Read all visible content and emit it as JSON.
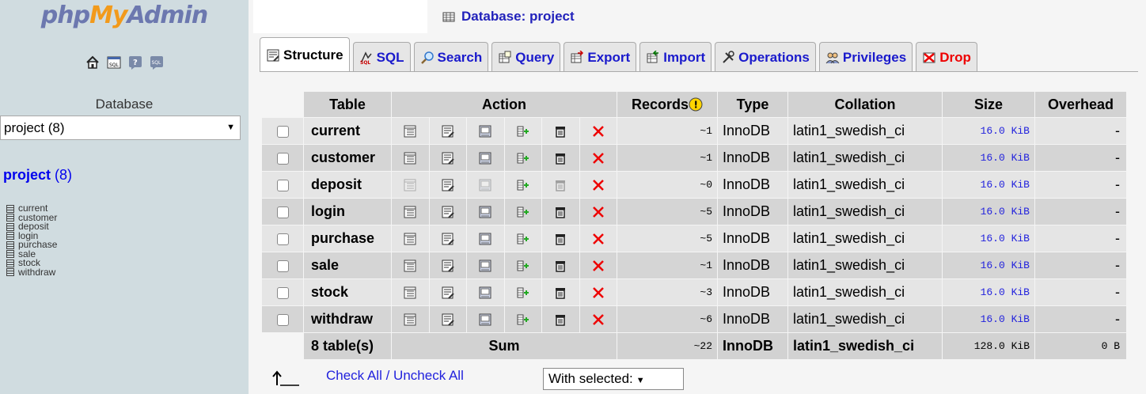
{
  "left": {
    "logo": {
      "php": "php",
      "my": "My",
      "admin": "Admin"
    },
    "icons": [
      "home-icon",
      "sql-query-icon",
      "help-icon",
      "sql-window-icon"
    ],
    "db_label": "Database",
    "db_select": "project (8)",
    "db_link_name": "project",
    "db_link_count": "(8)",
    "tables": [
      "current",
      "customer",
      "deposit",
      "login",
      "purchase",
      "sale",
      "stock",
      "withdraw"
    ]
  },
  "header": {
    "crumb": "Database: project"
  },
  "tabs": [
    {
      "label": "Structure",
      "icon": "structure-icon",
      "active": true
    },
    {
      "label": "SQL",
      "icon": "sql-icon"
    },
    {
      "label": "Search",
      "icon": "search-icon"
    },
    {
      "label": "Query",
      "icon": "query-icon"
    },
    {
      "label": "Export",
      "icon": "export-icon"
    },
    {
      "label": "Import",
      "icon": "import-icon"
    },
    {
      "label": "Operations",
      "icon": "operations-icon"
    },
    {
      "label": "Privileges",
      "icon": "privileges-icon"
    },
    {
      "label": "Drop",
      "icon": "drop-icon"
    }
  ],
  "table": {
    "headers": {
      "table": "Table",
      "action": "Action",
      "records": "Records",
      "type": "Type",
      "collation": "Collation",
      "size": "Size",
      "overhead": "Overhead"
    },
    "rows": [
      {
        "name": "current",
        "records": "~1",
        "type": "InnoDB",
        "collation": "latin1_swedish_ci",
        "size": "16.0 KiB",
        "overhead": "-",
        "empty": false
      },
      {
        "name": "customer",
        "records": "~1",
        "type": "InnoDB",
        "collation": "latin1_swedish_ci",
        "size": "16.0 KiB",
        "overhead": "-",
        "empty": false
      },
      {
        "name": "deposit",
        "records": "~0",
        "type": "InnoDB",
        "collation": "latin1_swedish_ci",
        "size": "16.0 KiB",
        "overhead": "-",
        "empty": true
      },
      {
        "name": "login",
        "records": "~5",
        "type": "InnoDB",
        "collation": "latin1_swedish_ci",
        "size": "16.0 KiB",
        "overhead": "-",
        "empty": false
      },
      {
        "name": "purchase",
        "records": "~5",
        "type": "InnoDB",
        "collation": "latin1_swedish_ci",
        "size": "16.0 KiB",
        "overhead": "-",
        "empty": false
      },
      {
        "name": "sale",
        "records": "~1",
        "type": "InnoDB",
        "collation": "latin1_swedish_ci",
        "size": "16.0 KiB",
        "overhead": "-",
        "empty": false
      },
      {
        "name": "stock",
        "records": "~3",
        "type": "InnoDB",
        "collation": "latin1_swedish_ci",
        "size": "16.0 KiB",
        "overhead": "-",
        "empty": false
      },
      {
        "name": "withdraw",
        "records": "~6",
        "type": "InnoDB",
        "collation": "latin1_swedish_ci",
        "size": "16.0 KiB",
        "overhead": "-",
        "empty": false
      }
    ],
    "footer": {
      "tables": "8 table(s)",
      "sum": "Sum",
      "records": "~22",
      "type": "InnoDB",
      "collation": "latin1_swedish_ci",
      "size": "128.0 KiB",
      "overhead": "0 B"
    }
  },
  "bottom": {
    "check_all": "Check All",
    "separator": " / ",
    "uncheck_all": "Uncheck All",
    "with_selected": "With selected:"
  },
  "colors": {
    "left_bg": "#d0dce0",
    "link": "#2222dd",
    "drop": "#e00000",
    "row_odd": "#e5e5e5",
    "row_even": "#d5d5d5"
  }
}
